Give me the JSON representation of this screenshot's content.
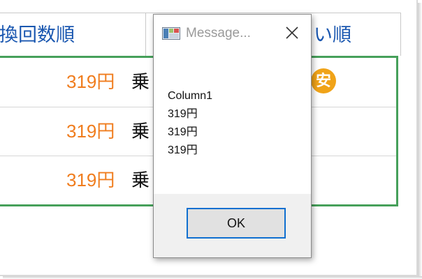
{
  "background_app": {
    "sort_tabs": [
      {
        "label": "換回数順"
      },
      {
        "label": "い順"
      }
    ],
    "routes": [
      {
        "price": "319円",
        "transfer_label": "乗",
        "badge": "安"
      },
      {
        "price": "319円",
        "transfer_label": "乗"
      },
      {
        "price": "319円",
        "transfer_label": "乗"
      }
    ],
    "colors": {
      "accent_blue": "#1a57b0",
      "price_orange": "#f07d1e",
      "list_border_green": "#46a05a",
      "badge_orange": "#f0a318"
    }
  },
  "dialog": {
    "title": "Message...",
    "close_icon": "close-icon",
    "lines": [
      "Column1",
      "319円",
      "319円",
      "319円"
    ],
    "ok_label": "OK"
  }
}
